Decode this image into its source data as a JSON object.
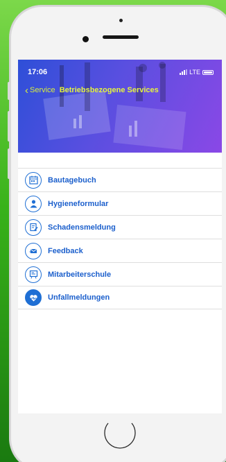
{
  "status_bar": {
    "time": "17:06",
    "network": "LTE"
  },
  "navigation": {
    "back_label": "Service",
    "title": "Betriebsbezogene Services"
  },
  "services": [
    {
      "label": "Bautagebuch",
      "icon": "calendar-icon"
    },
    {
      "label": "Hygieneformular",
      "icon": "person-icon"
    },
    {
      "label": "Schadensmeldung",
      "icon": "document-edit-icon"
    },
    {
      "label": "Feedback",
      "icon": "envelope-icon"
    },
    {
      "label": "Mitarbeiterschule",
      "icon": "whiteboard-icon"
    },
    {
      "label": "Unfallmeldungen",
      "icon": "heart-icon"
    }
  ],
  "colors": {
    "accent": "#1b5fcc",
    "nav_title": "#e6f53c",
    "background": "#38b21a"
  }
}
